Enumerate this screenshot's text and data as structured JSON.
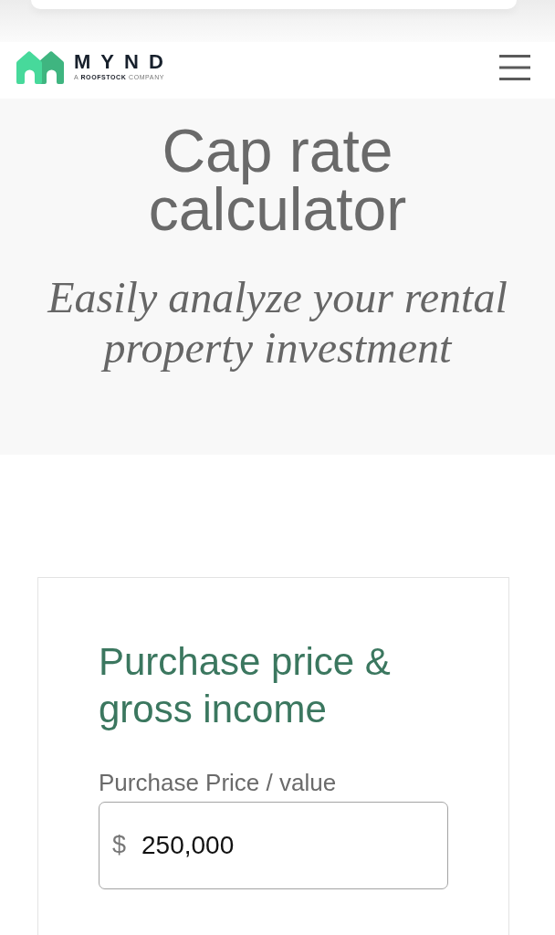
{
  "header": {
    "logo": {
      "wordmark": "MYND",
      "tagline": "A **ROOFSTOCK** COMPANY"
    }
  },
  "hero": {
    "title": "Cap rate calculator",
    "subtitle": "Easily analyze your rental property investment"
  },
  "calculator": {
    "section_title": "Purchase price & gross income",
    "fields": [
      {
        "label": "Purchase Price / value",
        "prefix": "$",
        "value": "250,000"
      }
    ]
  }
}
